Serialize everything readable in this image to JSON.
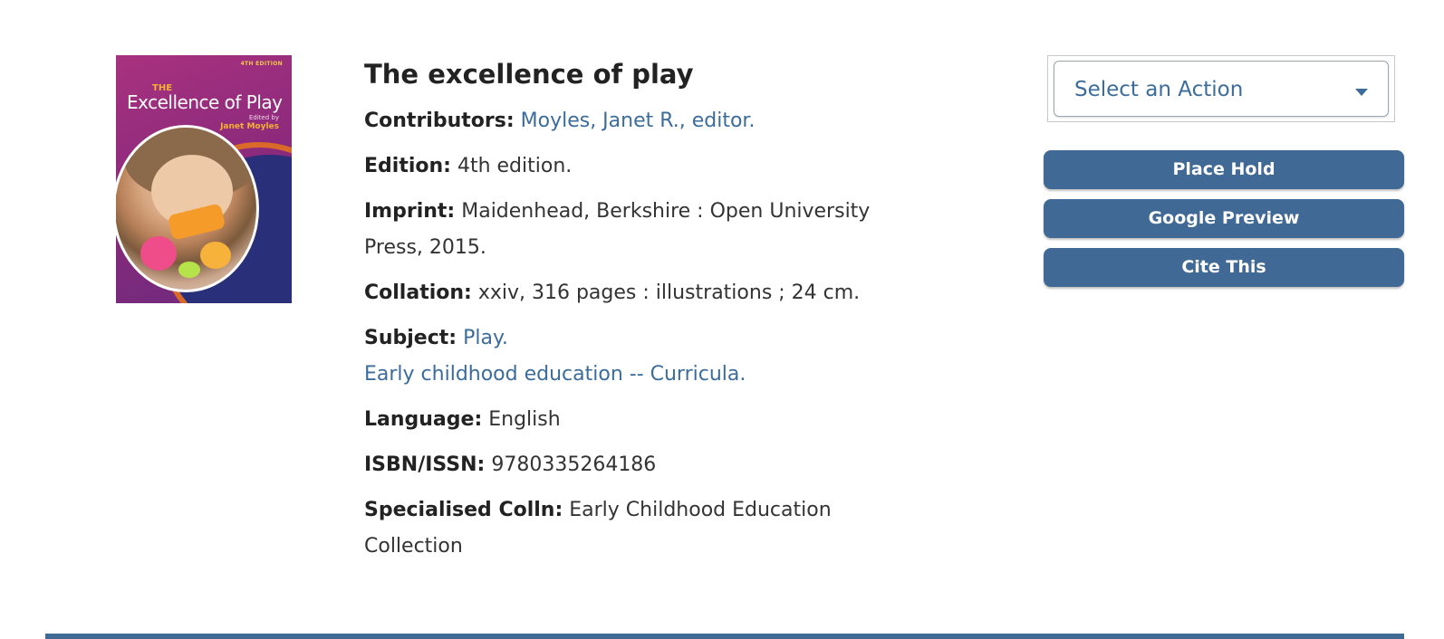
{
  "book": {
    "title": "The excellence of play",
    "cover": {
      "edition_tag": "4TH EDITION",
      "the": "THE",
      "title": "Excellence of Play",
      "edited_by": "Edited by",
      "editor": "Janet Moyles"
    },
    "fields": {
      "contributors": {
        "label": "Contributors:",
        "value": "Moyles, Janet R., editor."
      },
      "edition": {
        "label": "Edition:",
        "value": "4th edition."
      },
      "imprint": {
        "label": "Imprint:",
        "value": "Maidenhead, Berkshire : Open University Press, 2015."
      },
      "collation": {
        "label": "Collation:",
        "value": "xxiv, 316 pages : illustrations ; 24 cm."
      },
      "subject": {
        "label": "Subject:",
        "values": [
          "Play.",
          "Early childhood education -- Curricula."
        ]
      },
      "language": {
        "label": "Language:",
        "value": "English"
      },
      "isbn": {
        "label": "ISBN/ISSN:",
        "value": "9780335264186"
      },
      "specialised": {
        "label": "Specialised Colln:",
        "value": "Early Childhood Education Collection"
      }
    }
  },
  "actions": {
    "select_placeholder": "Select an Action",
    "place_hold": "Place Hold",
    "google_preview": "Google Preview",
    "cite_this": "Cite This"
  },
  "colors": {
    "link": "#3b6c9c",
    "button": "#406a95"
  }
}
